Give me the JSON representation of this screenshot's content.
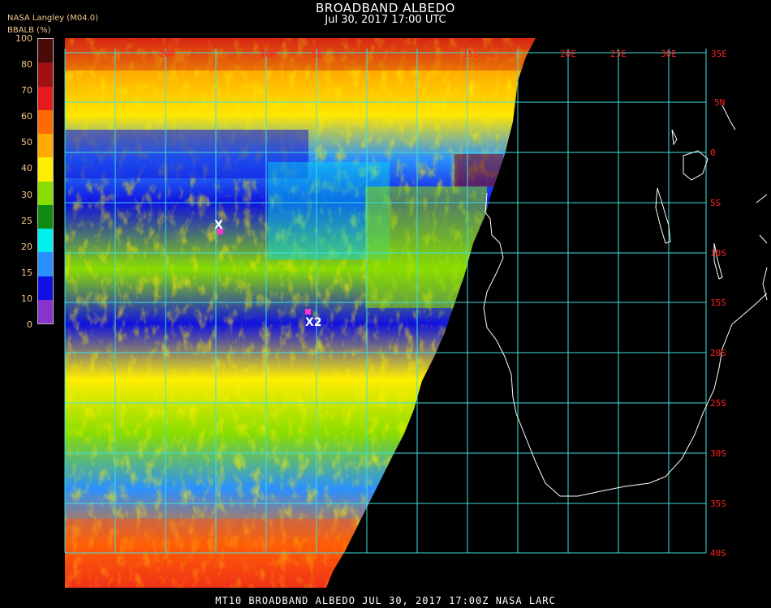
{
  "header": {
    "title": "BROADBAND ALBEDO",
    "subtitle": "Jul 30, 2017 17:00 UTC",
    "credit": "NASA Langley (M04.0)",
    "colorbar_label": "BBALB (%)"
  },
  "colorbar": {
    "ticks": [
      "100",
      "80",
      "70",
      "60",
      "50",
      "40",
      "30",
      "25",
      "20",
      "15",
      "10",
      "0"
    ],
    "colors": [
      "#4a0a0a",
      "#a01010",
      "#e41b1b",
      "#ff6a00",
      "#ffaa00",
      "#ffee00",
      "#88dd00",
      "#108a10",
      "#00f0f0",
      "#2a90ff",
      "#1010e0",
      "#8833cc"
    ]
  },
  "map": {
    "lon_labels": [
      "20W",
      "10W",
      "5E",
      "15E",
      "20E",
      "25E",
      "30E",
      "35E"
    ],
    "lat_labels": [
      "5N",
      "0",
      "5S",
      "10S",
      "15S",
      "20S",
      "25S",
      "30S",
      "35S",
      "40S"
    ],
    "markers": [
      {
        "label": "X"
      },
      {
        "label": "X2"
      }
    ],
    "grid_color": "#40e0e0",
    "label_color": "#ff2020"
  },
  "footer": "MT10  BROADBAND ALBEDO   JUL 30, 2017 17:00Z   NASA LARC"
}
